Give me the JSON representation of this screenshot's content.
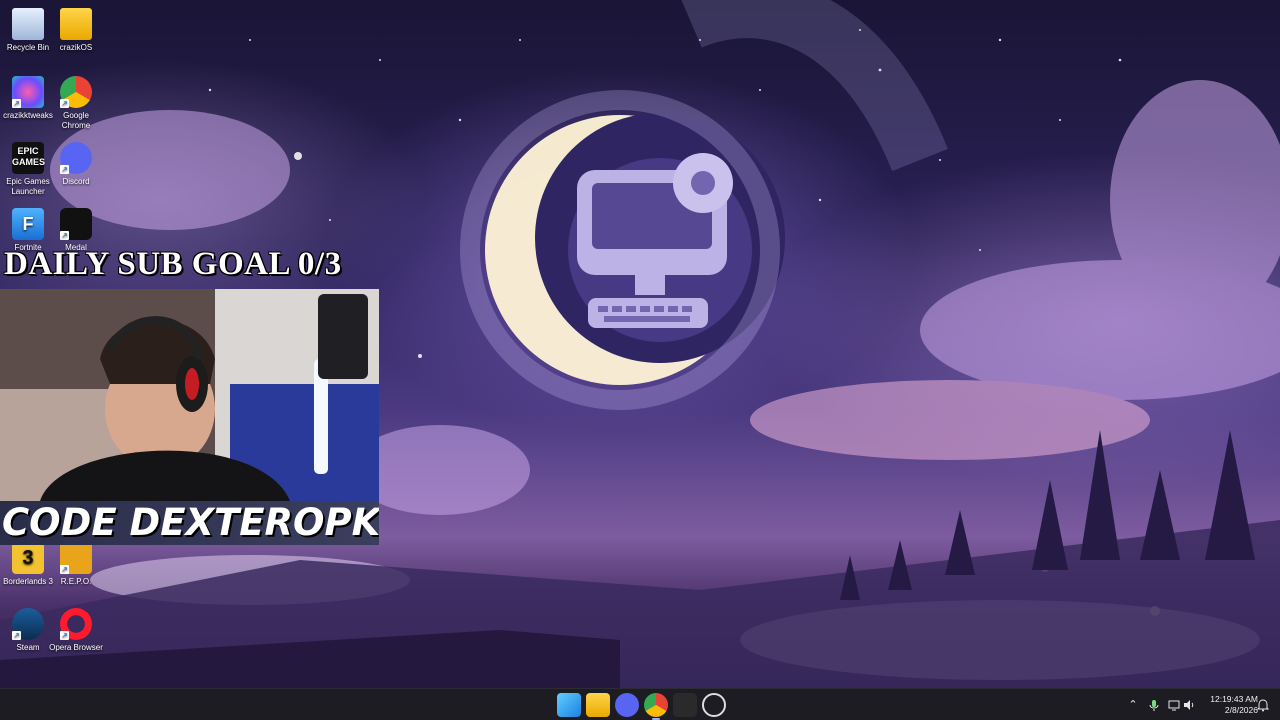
{
  "desktop_icons": [
    {
      "label": "Recycle Bin",
      "icon": "recycle-bin-icon"
    },
    {
      "label": "crazikOS",
      "icon": "folder-icon"
    },
    {
      "label": "crazikktweaks",
      "icon": "crazikktweaks-icon"
    },
    {
      "label": "Google Chrome",
      "icon": "chrome-icon"
    },
    {
      "label": "Epic Games Launcher",
      "icon": "epic-games-icon",
      "glyph_text": "EPIC GAMES"
    },
    {
      "label": "Discord",
      "icon": "discord-icon"
    },
    {
      "label": "Fortnite",
      "icon": "fortnite-icon",
      "glyph_text": "F"
    },
    {
      "label": "Medal",
      "icon": "medal-icon"
    },
    {
      "label": "Borderlands 3",
      "icon": "borderlands-icon",
      "glyph_text": "3"
    },
    {
      "label": "R.E.P.O.",
      "icon": "repo-icon"
    },
    {
      "label": "Steam",
      "icon": "steam-icon"
    },
    {
      "label": "Opera Browser",
      "icon": "opera-icon"
    }
  ],
  "overlay": {
    "sub_goal": "DAILY SUB GOAL 0/3",
    "code_banner": "CODE DEXTEROPK"
  },
  "taskbar": {
    "apps": [
      {
        "name": "start",
        "icon": "windows-start-icon"
      },
      {
        "name": "file-explorer",
        "icon": "folder-icon"
      },
      {
        "name": "discord",
        "icon": "discord-icon"
      },
      {
        "name": "chrome",
        "icon": "chrome-icon",
        "active": true
      },
      {
        "name": "epic-games",
        "icon": "epic-games-icon"
      },
      {
        "name": "clock-app",
        "icon": "clock-icon"
      }
    ],
    "tray": [
      "chevron-up-icon",
      "microphone-icon",
      "network-icon",
      "volume-icon",
      "notification-bell-icon"
    ],
    "time": "12:19:43 AM",
    "date": "2/8/2026"
  },
  "colors": {
    "taskbar": "#1c1c22",
    "accent": "#9aa7ff"
  }
}
